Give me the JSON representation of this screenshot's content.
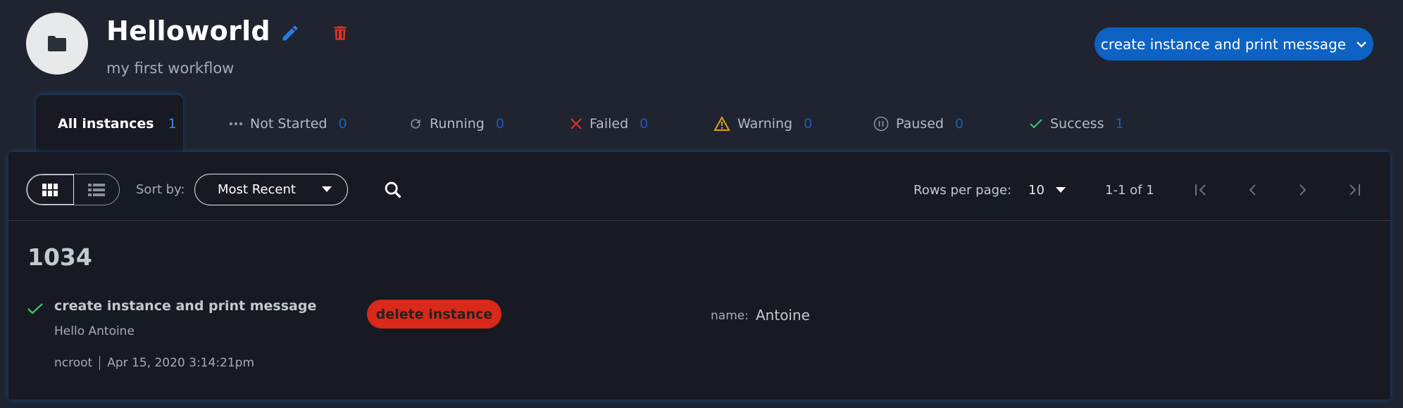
{
  "workflow": {
    "title": "Helloworld",
    "subtitle": "my first workflow",
    "run_button_label": "create instance and print message"
  },
  "tabs": [
    {
      "label": "All instances",
      "count": "1",
      "active": true
    },
    {
      "label": "Not Started",
      "count": "0",
      "icon": "dots-icon"
    },
    {
      "label": "Running",
      "count": "0",
      "icon": "refresh-icon"
    },
    {
      "label": "Failed",
      "count": "0",
      "icon": "x-icon"
    },
    {
      "label": "Warning",
      "count": "0",
      "icon": "warning-icon"
    },
    {
      "label": "Paused",
      "count": "0",
      "icon": "pause-icon"
    },
    {
      "label": "Success",
      "count": "1",
      "icon": "check-icon"
    }
  ],
  "toolbar": {
    "view_modes": [
      "grid-view",
      "list-view"
    ],
    "sort_label": "Sort by:",
    "sort_value": "Most Recent",
    "rows_per_page_label": "Rows per page:",
    "rows_per_page_value": "10",
    "range": "1-1 of 1"
  },
  "instance": {
    "id": "1034",
    "state_name": "create instance and print message",
    "message": "Hello Antoine",
    "user": "ncroot",
    "timestamp": "Apr 15, 2020 3:14:21pm",
    "delete_label": "delete instance",
    "field_label": "name:",
    "field_value": "Antoine"
  },
  "colors": {
    "accent": "#0d62c4",
    "danger": "#d8291a",
    "success": "#3fbf6a",
    "warning": "#e0a019",
    "background": "#1f2430",
    "panel": "#171a22"
  }
}
